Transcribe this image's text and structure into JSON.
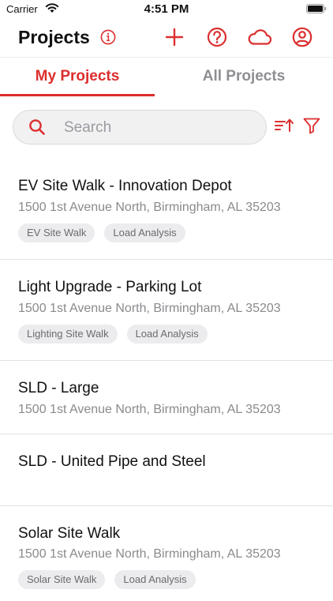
{
  "status_bar": {
    "carrier": "Carrier",
    "time": "4:51 PM"
  },
  "header": {
    "title": "Projects",
    "icons": [
      "info-icon",
      "add-icon",
      "help-icon",
      "cloud-icon",
      "account-icon"
    ]
  },
  "tabs": [
    {
      "label": "My Projects",
      "active": true
    },
    {
      "label": "All Projects",
      "active": false
    }
  ],
  "search": {
    "placeholder": "Search",
    "value": ""
  },
  "toolbar_icons": [
    "sort-icon",
    "filter-icon"
  ],
  "projects": [
    {
      "name": "EV Site Walk - Innovation Depot",
      "address": "1500 1st Avenue North, Birmingham, AL 35203",
      "tags": [
        "EV Site Walk",
        "Load Analysis"
      ]
    },
    {
      "name": "Light Upgrade - Parking Lot",
      "address": "1500 1st Avenue North, Birmingham, AL 35203",
      "tags": [
        "Lighting Site Walk",
        "Load Analysis"
      ]
    },
    {
      "name": "SLD - Large",
      "address": "1500 1st Avenue North, Birmingham, AL 35203",
      "tags": []
    },
    {
      "name": "SLD - United Pipe and Steel",
      "address": "",
      "tags": []
    },
    {
      "name": "Solar Site Walk",
      "address": "1500 1st Avenue North, Birmingham, AL 35203",
      "tags": [
        "Solar Site Walk",
        "Load Analysis"
      ]
    }
  ],
  "colors": {
    "accent": "#dc2e2e",
    "muted": "#8e8e93",
    "tag_bg": "#ececee"
  }
}
